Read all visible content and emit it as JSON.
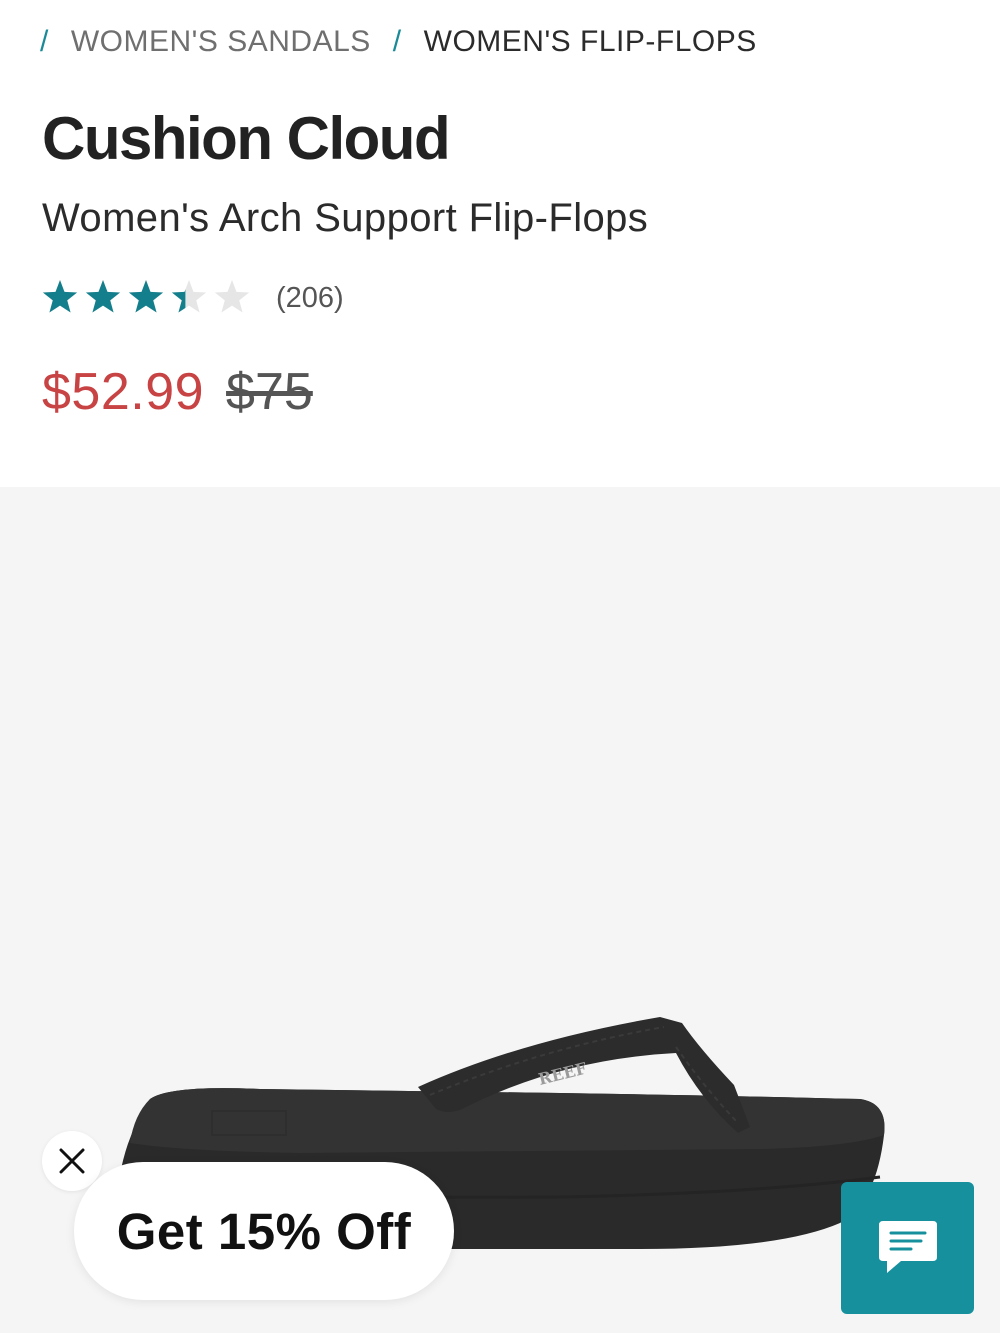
{
  "breadcrumb": {
    "items": [
      {
        "label": "WOMEN'S SANDALS"
      },
      {
        "label": "WOMEN'S FLIP-FLOPS"
      }
    ]
  },
  "product": {
    "title": "Cushion Cloud",
    "subtitle": "Women's Arch Support Flip-Flops",
    "rating": {
      "value": 3.4,
      "max": 5,
      "review_count": "(206)"
    },
    "price": {
      "sale": "$52.99",
      "original": "$75"
    }
  },
  "promo": {
    "label": "Get 15% Off"
  },
  "colors": {
    "accent": "#17909e",
    "star": "#147f8c",
    "sale_price": "#c84343",
    "image_bg": "#f5f5f5"
  },
  "icons": {
    "breadcrumb_separator": "slash",
    "close": "close-icon",
    "chat": "chat-bubble-icon"
  }
}
